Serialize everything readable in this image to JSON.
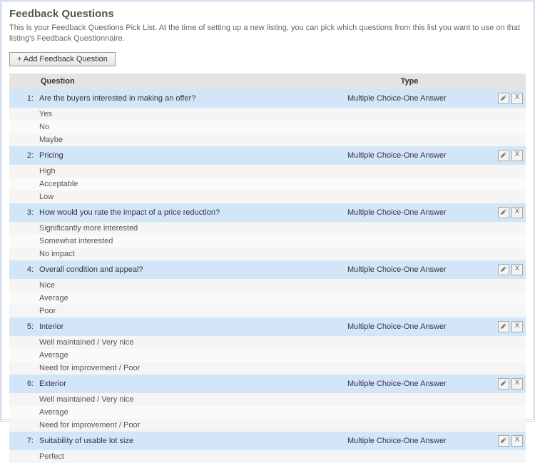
{
  "page": {
    "title": "Feedback Questions",
    "intro": "This is your Feedback Questions Pick List. At the time of setting up a new listing, you can pick which questions from this list you want to use on that listing's Feedback Questionnaire.",
    "add_button": "+ Add Feedback Question"
  },
  "table": {
    "headers": {
      "question": "Question",
      "type": "Type"
    },
    "type_label": "Multiple Choice-One Answer"
  },
  "questions": [
    {
      "num": "1:",
      "text": "Are the buyers interested in making an offer?",
      "answers": [
        "Yes",
        "No",
        "Maybe"
      ]
    },
    {
      "num": "2:",
      "text": "Pricing",
      "answers": [
        "High",
        "Acceptable",
        "Low"
      ]
    },
    {
      "num": "3:",
      "text": "How would you rate the impact of a price reduction?",
      "answers": [
        "Significantly more interested",
        "Somewhat interested",
        "No impact"
      ]
    },
    {
      "num": "4:",
      "text": "Overall condition and appeal?",
      "answers": [
        "Nice",
        "Average",
        "Poor"
      ]
    },
    {
      "num": "5:",
      "text": "Interior",
      "answers": [
        "Well maintained / Very nice",
        "Average",
        "Need for improvement / Poor"
      ]
    },
    {
      "num": "6:",
      "text": "Exterior",
      "answers": [
        "Well maintained / Very nice",
        "Average",
        "Need for improvement / Poor"
      ]
    },
    {
      "num": "7:",
      "text": "Suitability of usable lot size",
      "answers": [
        "Perfect"
      ]
    }
  ]
}
